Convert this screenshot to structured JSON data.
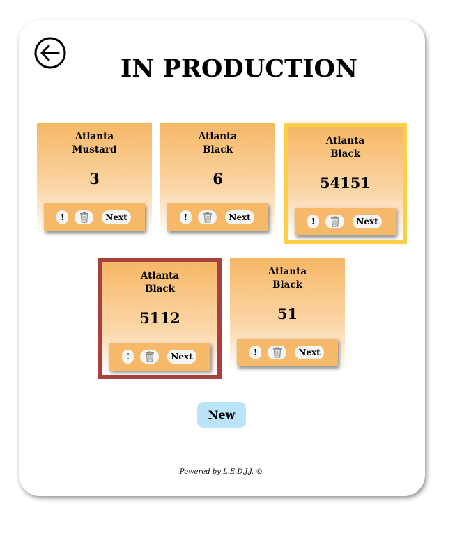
{
  "header": {
    "title": "IN PRODUCTION",
    "back_icon": "arrow-left-circle-icon"
  },
  "cards": [
    {
      "line1": "Atlanta",
      "line2": "Mustard",
      "quantity": "3",
      "info_label": "!",
      "next_label": "Next",
      "selection": "none"
    },
    {
      "line1": "Atlanta",
      "line2": "Black",
      "quantity": "6",
      "info_label": "!",
      "next_label": "Next",
      "selection": "none"
    },
    {
      "line1": "Atlanta",
      "line2": "Black",
      "quantity": "54151",
      "info_label": "!",
      "next_label": "Next",
      "selection": "yellow"
    },
    {
      "line1": "Atlanta",
      "line2": "Black",
      "quantity": "5112",
      "info_label": "!",
      "next_label": "Next",
      "selection": "red"
    },
    {
      "line1": "Atlanta",
      "line2": "Black",
      "quantity": "51",
      "info_label": "!",
      "next_label": "Next",
      "selection": "none"
    }
  ],
  "actions": {
    "new_label": "New"
  },
  "footer": {
    "text": "Powered by L.E.D.J.J. ©"
  },
  "colors": {
    "card_top": "#f6b766",
    "card_bar": "#f6b96a",
    "highlight_yellow": "#fdcf47",
    "highlight_red": "#a9403d",
    "new_button": "#b9e4f9"
  }
}
